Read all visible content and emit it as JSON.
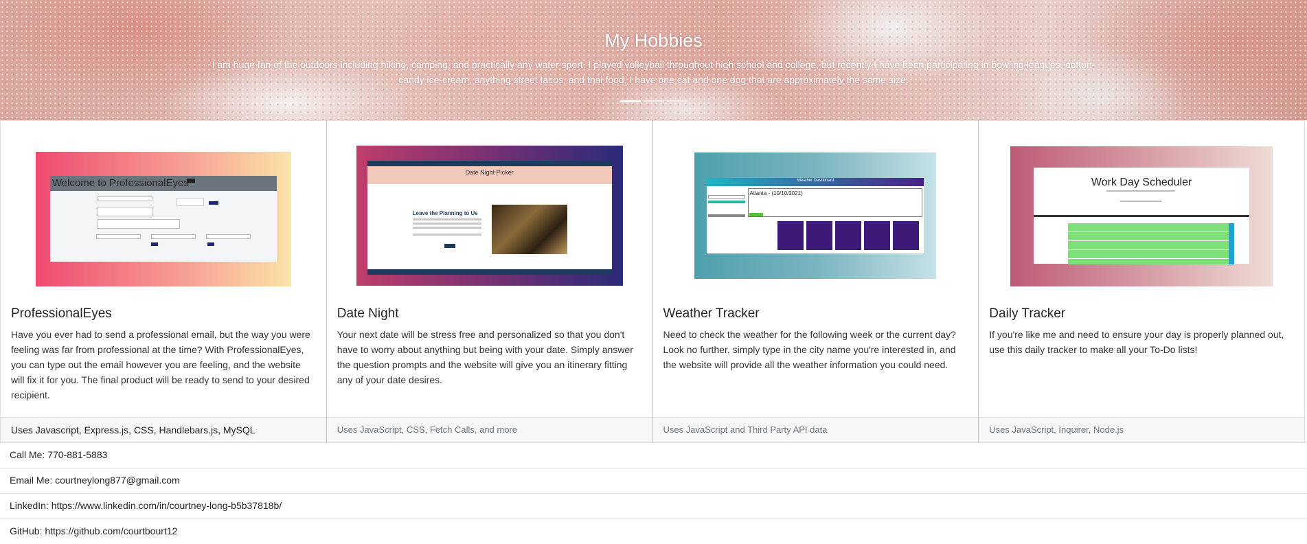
{
  "hero": {
    "title": "My Hobbies",
    "text": "I am huge fan of the outdoors including hiking, camping, and practically any water sport. I played volleyball throughout high school and college, but recently I have been participating in bowling leagues. cotton-candy ice-cream, anything street tacos, and thai food. I have one cat and one dog that are approximately the same size.",
    "indicators": [
      "slide-1",
      "slide-2",
      "slide-3"
    ]
  },
  "projects": [
    {
      "title": "ProfessionalEyes",
      "text": "Have you ever had to send a professional email, but the way you were feeling was far from professional at the time? With ProfessionalEyes, you can type out the email however you are feeling, and the website will fix it for you. The final product will be ready to send to your desired recipient.",
      "footer": "Uses Javascript, Express.js, CSS, Handlebars.js, MySQL",
      "thumb_heading": "Welcome to ProfessionalEyes"
    },
    {
      "title": "Date Night",
      "text": "Your next date will be stress free and personalized so that you don't have to worry about anything but being with your date. Simply answer the question prompts and the website will give you an itinerary fitting any of your date desires.",
      "footer": "Uses JavaScript, CSS, Fetch Calls, and more",
      "thumb_heading": "Date Night Picker",
      "thumb_sub": "Leave the Planning to Us"
    },
    {
      "title": "Weather Tracker",
      "text": "Need to check the weather for the following week or the current day? Look no further, simply type in the city name you're interested in, and the website will provide all the weather information you could need.",
      "footer": "Uses JavaScript and Third Party API data",
      "thumb_heading": "Weather Dashboard",
      "thumb_city": "Atlanta - (10/10/2021)"
    },
    {
      "title": "Daily Tracker",
      "text": "If you're like me and need to ensure your day is properly planned out, use this daily tracker to make all your To-Do lists!",
      "footer": "Uses JavaScript, Inquirer, Node.js",
      "thumb_heading": "Work Day Scheduler"
    }
  ],
  "contacts": [
    "Call Me: 770-881-5883",
    "Email Me: courtneylong877@gmail.com",
    "LinkedIn: https://www.linkedin.com/in/courtney-long-b5b37818b/",
    "GitHub: https://github.com/courtbourt12"
  ]
}
